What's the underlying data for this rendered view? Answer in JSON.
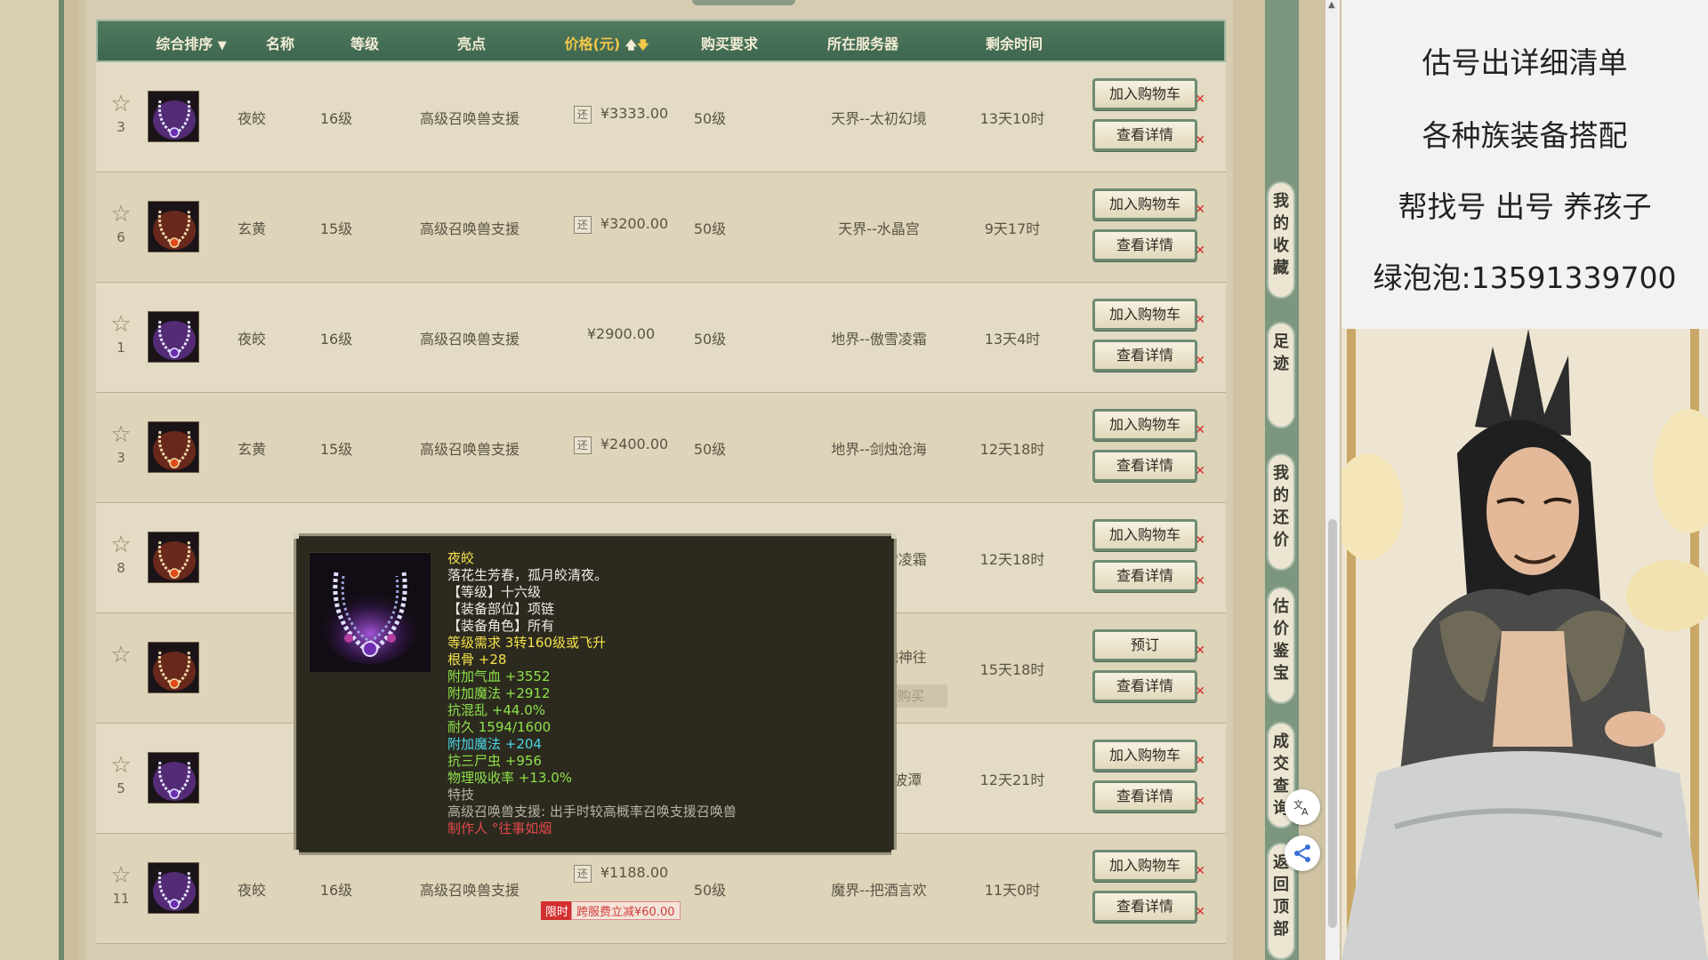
{
  "header": {
    "sort_label": "综合排序",
    "name": "名称",
    "level": "等级",
    "highlight": "亮点",
    "price": "价格(元)",
    "requirement": "购买要求",
    "server": "所在服务器",
    "remaining": "剩余时间"
  },
  "rows": [
    {
      "fav": "3",
      "icon": "purple-necklace",
      "name": "夜皎",
      "level": "16级",
      "highlight": "高级召唤兽支援",
      "price": "¥3333.00",
      "bargain": true,
      "req": "50级",
      "server": "天界--太初幻境",
      "time": "13天10时",
      "action": "加入购物车",
      "detail": "查看详情"
    },
    {
      "fav": "6",
      "icon": "red-necklace",
      "name": "玄黄",
      "level": "15级",
      "highlight": "高级召唤兽支援",
      "price": "¥3200.00",
      "bargain": true,
      "req": "50级",
      "server": "天界--水晶宫",
      "time": "9天17时",
      "action": "加入购物车",
      "detail": "查看详情"
    },
    {
      "fav": "1",
      "icon": "purple-necklace",
      "name": "夜皎",
      "level": "16级",
      "highlight": "高级召唤兽支援",
      "price": "¥2900.00",
      "bargain": false,
      "req": "50级",
      "server": "地界--傲雪凌霜",
      "time": "13天4时",
      "action": "加入购物车",
      "detail": "查看详情"
    },
    {
      "fav": "3",
      "icon": "red-necklace",
      "name": "玄黄",
      "level": "15级",
      "highlight": "高级召唤兽支援",
      "price": "¥2400.00",
      "bargain": true,
      "req": "50级",
      "server": "地界--剑烛沧海",
      "time": "12天18时",
      "action": "加入购物车",
      "detail": "查看详情"
    },
    {
      "fav": "8",
      "icon": "red-necklace",
      "name": "",
      "level": "",
      "highlight": "",
      "price": "",
      "bargain": false,
      "req": "",
      "server": "地界--傲雪凌霜",
      "time": "12天18时",
      "action": "加入购物车",
      "detail": "查看详情"
    },
    {
      "fav": "",
      "icon": "red-necklace",
      "name": "",
      "level": "",
      "highlight": "",
      "price": "",
      "bargain": false,
      "req": "",
      "server": "天界--星驰神往",
      "server_note": "该服务器不能购买",
      "time": "15天18时",
      "action": "预订",
      "detail": "查看详情"
    },
    {
      "fav": "5",
      "icon": "purple-necklace",
      "name": "",
      "level": "",
      "highlight": "",
      "price": "",
      "bargain": false,
      "req": "",
      "server": "人界 --碧波潭",
      "time": "12天21时",
      "action": "加入购物车",
      "detail": "查看详情"
    },
    {
      "fav": "11",
      "icon": "purple-necklace",
      "name": "夜皎",
      "level": "16级",
      "highlight": "高级召唤兽支援",
      "price": "¥1188.00",
      "bargain": true,
      "limit_tag": "限时",
      "limit_text": "跨服费立减¥60.00",
      "req": "50级",
      "server": "魔界--把酒言欢",
      "time": "11天0时",
      "action": "加入购物车",
      "detail": "查看详情"
    }
  ],
  "bargain_glyph": "还",
  "tooltip": {
    "title": "夜皎",
    "lines": [
      {
        "text": "落花生芳春，孤月皎清夜。",
        "color": "white"
      },
      {
        "text": "【等级】十六级",
        "color": "white"
      },
      {
        "text": "【装备部位】项链",
        "color": "white"
      },
      {
        "text": "【装备角色】所有",
        "color": "white"
      },
      {
        "text": "等级需求 3转160级或飞升",
        "color": "yellow"
      },
      {
        "text": "根骨 +28",
        "color": "yellow"
      },
      {
        "text": "附加气血 +3552",
        "color": "green"
      },
      {
        "text": "附加魔法 +2912",
        "color": "green"
      },
      {
        "text": "抗混乱 +44.0%",
        "color": "green"
      },
      {
        "text": "耐久 1594/1600",
        "color": "green"
      },
      {
        "text": "附加魔法 +204",
        "color": "cyan"
      },
      {
        "text": "抗三尸虫 +956",
        "color": "green"
      },
      {
        "text": "物理吸收率 +13.0%",
        "color": "green"
      },
      {
        "text": "特技",
        "color": "gray"
      },
      {
        "text": "高级召唤兽支援: 出手时较高概率召唤支援召唤兽",
        "color": "gray"
      },
      {
        "text": "制作人 °往事如烟",
        "color": "red"
      }
    ]
  },
  "side_tabs": [
    {
      "label": "我的收藏"
    },
    {
      "label": "足迹"
    },
    {
      "label": "我的还价"
    },
    {
      "label": "估价鉴宝"
    },
    {
      "label": "成交查询"
    },
    {
      "label": "返回顶部"
    }
  ],
  "float_buttons": [
    "translate-icon",
    "share-icon"
  ],
  "right_panel": {
    "lines": [
      "估号出详细清单",
      "各种族装备搭配",
      "帮找号 出号 养孩子",
      "绿泡泡:13591339700"
    ]
  },
  "colors": {
    "header_bg": "#3e6650",
    "accent_red": "#d72b2b",
    "tooltip_bg": "#2c2a1f"
  }
}
